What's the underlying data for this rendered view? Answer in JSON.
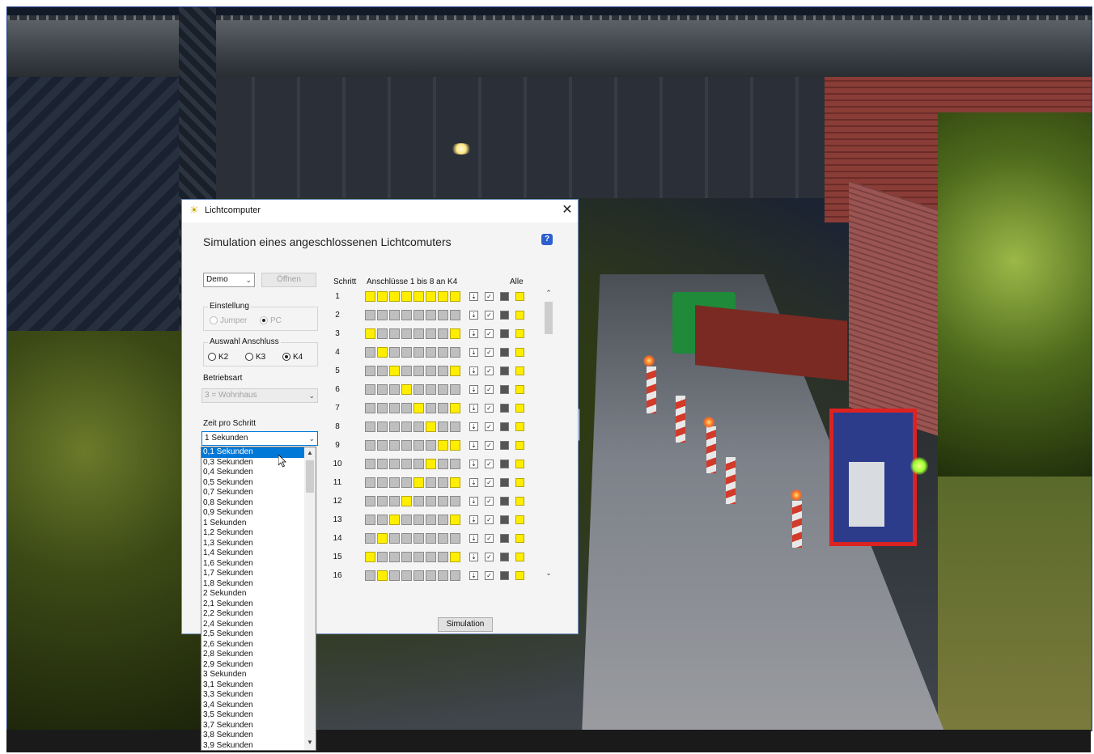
{
  "window": {
    "title": "Lichtcomputer",
    "close": "✕",
    "heading": "Simulation eines angeschlossenen Lichtcomuters",
    "help": "?"
  },
  "controls": {
    "mode_select": "Demo",
    "open_button": "Öffnen",
    "einstellung_label": "Einstellung",
    "jumper_label": "Jumper",
    "pc_label": "PC",
    "anschluss_label": "Auswahl Anschluss",
    "k2_label": "K2",
    "k3_label": "K3",
    "k4_label": "K4",
    "betriebsart_label": "Betriebsart",
    "betriebsart_value": "3 = Wohnhaus",
    "zeit_label": "Zeit pro Schritt",
    "zeit_value": "1 Sekunden",
    "simulation_button": "Simulation"
  },
  "grid": {
    "schritt_header": "Schritt",
    "anschluesse_header": "Anschlüsse 1 bis 8 an K4",
    "alle_header": "Alle",
    "rows": [
      {
        "n": "1",
        "on": [
          1,
          1,
          1,
          1,
          1,
          1,
          1,
          1
        ]
      },
      {
        "n": "2",
        "on": [
          0,
          0,
          0,
          0,
          0,
          0,
          0,
          0
        ]
      },
      {
        "n": "3",
        "on": [
          1,
          0,
          0,
          0,
          0,
          0,
          0,
          1
        ]
      },
      {
        "n": "4",
        "on": [
          0,
          1,
          0,
          0,
          0,
          0,
          0,
          0
        ]
      },
      {
        "n": "5",
        "on": [
          0,
          0,
          1,
          0,
          0,
          0,
          0,
          1
        ]
      },
      {
        "n": "6",
        "on": [
          0,
          0,
          0,
          1,
          0,
          0,
          0,
          0
        ]
      },
      {
        "n": "7",
        "on": [
          0,
          0,
          0,
          0,
          1,
          0,
          0,
          1
        ]
      },
      {
        "n": "8",
        "on": [
          0,
          0,
          0,
          0,
          0,
          1,
          0,
          0
        ]
      },
      {
        "n": "9",
        "on": [
          0,
          0,
          0,
          0,
          0,
          0,
          1,
          1
        ]
      },
      {
        "n": "10",
        "on": [
          0,
          0,
          0,
          0,
          0,
          1,
          0,
          0
        ]
      },
      {
        "n": "11",
        "on": [
          0,
          0,
          0,
          0,
          1,
          0,
          0,
          1
        ]
      },
      {
        "n": "12",
        "on": [
          0,
          0,
          0,
          1,
          0,
          0,
          0,
          0
        ]
      },
      {
        "n": "13",
        "on": [
          0,
          0,
          1,
          0,
          0,
          0,
          0,
          1
        ]
      },
      {
        "n": "14",
        "on": [
          0,
          1,
          0,
          0,
          0,
          0,
          0,
          0
        ]
      },
      {
        "n": "15",
        "on": [
          1,
          0,
          0,
          0,
          0,
          0,
          0,
          1
        ]
      },
      {
        "n": "16",
        "on": [
          0,
          1,
          0,
          0,
          0,
          0,
          0,
          0
        ]
      }
    ]
  },
  "dropdown": {
    "options": [
      "0,1 Sekunden",
      "0,3 Sekunden",
      "0,4 Sekunden",
      "0,5 Sekunden",
      "0,7 Sekunden",
      "0,8 Sekunden",
      "0,9 Sekunden",
      "1 Sekunden",
      "1,2 Sekunden",
      "1,3 Sekunden",
      "1,4 Sekunden",
      "1,6 Sekunden",
      "1,7 Sekunden",
      "1,8 Sekunden",
      "2 Sekunden",
      "2,1 Sekunden",
      "2,2 Sekunden",
      "2,4 Sekunden",
      "2,5 Sekunden",
      "2,6 Sekunden",
      "2,8 Sekunden",
      "2,9 Sekunden",
      "3 Sekunden",
      "3,1 Sekunden",
      "3,3 Sekunden",
      "3,4 Sekunden",
      "3,5 Sekunden",
      "3,7 Sekunden",
      "3,8 Sekunden",
      "3,9 Sekunden"
    ],
    "highlighted": "0,1 Sekunden"
  },
  "colors": {
    "on_cell": "#ffee00",
    "off_cell": "#bfbfbf",
    "selection": "#0078d7"
  }
}
